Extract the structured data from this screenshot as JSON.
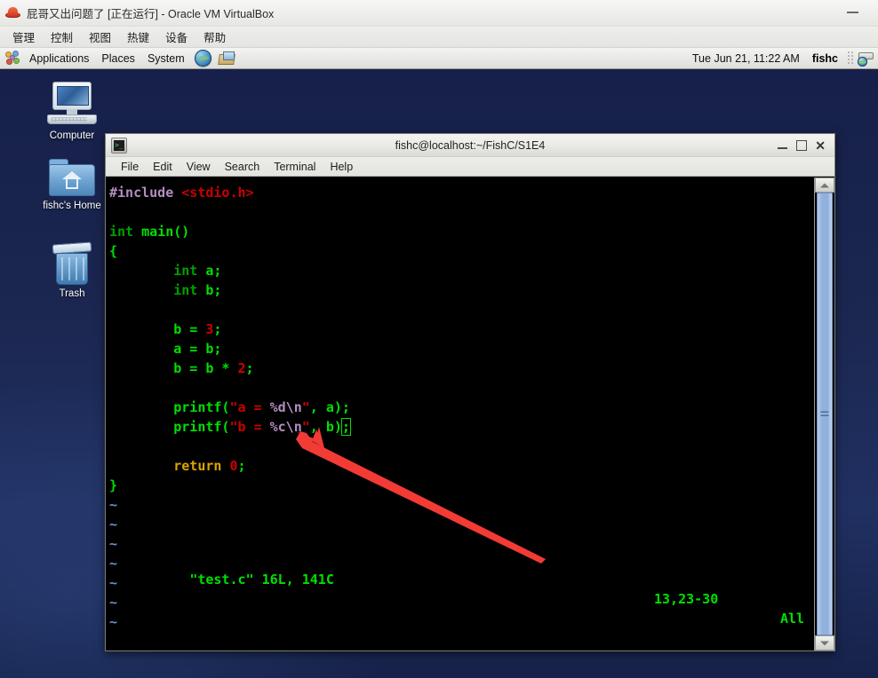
{
  "vbox": {
    "icon": "redhat-icon",
    "title_main": "屁哥又出问题了",
    "title_state": "[正在运行]",
    "title_app": "- Oracle VM VirtualBox",
    "title_full": "屁哥又出问题了 [正在运行] - Oracle VM VirtualBox",
    "minimize_label": "—",
    "menu": [
      {
        "label": "管理",
        "name": "vbox-menu-manage"
      },
      {
        "label": "控制",
        "name": "vbox-menu-control"
      },
      {
        "label": "视图",
        "name": "vbox-menu-view"
      },
      {
        "label": "热键",
        "name": "vbox-menu-hotkey"
      },
      {
        "label": "设备",
        "name": "vbox-menu-devices"
      },
      {
        "label": "帮助",
        "name": "vbox-menu-help"
      }
    ]
  },
  "gnome_panel": {
    "applications": "Applications",
    "places": "Places",
    "system": "System",
    "clock": "Tue Jun 21, 11:22 AM",
    "user": "fishc",
    "icons": {
      "apps": "applications-icon",
      "browser": "web-browser-icon",
      "mail": "evolution-mail-icon",
      "updates": "software-update-icon"
    }
  },
  "desktop": {
    "icons": [
      {
        "label": "Computer",
        "name": "desktop-icon-computer"
      },
      {
        "label": "fishc's Home",
        "name": "desktop-icon-home"
      },
      {
        "label": "Trash",
        "name": "desktop-icon-trash"
      }
    ]
  },
  "terminal": {
    "title": "fishc@localhost:~/FishC/S1E4",
    "menu": [
      {
        "label": "File",
        "name": "terminal-menu-file"
      },
      {
        "label": "Edit",
        "name": "terminal-menu-edit"
      },
      {
        "label": "View",
        "name": "terminal-menu-view"
      },
      {
        "label": "Search",
        "name": "terminal-menu-search"
      },
      {
        "label": "Terminal",
        "name": "terminal-menu-terminal"
      },
      {
        "label": "Help",
        "name": "terminal-menu-help"
      }
    ],
    "window_buttons": {
      "minimize": "_",
      "maximize": "□",
      "close": "✕"
    },
    "status": {
      "file": "\"test.c\" 16L, 141C",
      "position": "13,23-30",
      "scroll": "All"
    },
    "code": {
      "line01_include_kw": "#include ",
      "line01_header": "<stdio.h>",
      "line03_type": "int ",
      "line03_name": "main()",
      "line04_brace": "{",
      "line05_type": "int ",
      "line05_decl": "a;",
      "line06_type": "int ",
      "line06_decl": "b;",
      "line08_lhs": "b = ",
      "line08_num": "3",
      "line08_semi": ";",
      "line09_expr": "a = b;",
      "line10_lhs": "b = b * ",
      "line10_num": "2",
      "line10_semi": ";",
      "line12_call": "printf(",
      "line12_str_open": "\"a = ",
      "line12_fmt": "%d\\n",
      "line12_str_close": "\"",
      "line12_args": ", a);",
      "line13_call": "printf(",
      "line13_str_open": "\"b = ",
      "line13_fmt": "%c\\n",
      "line13_str_close": "\"",
      "line13_args": ", b)",
      "line13_cursor": ";",
      "line15_ret_kw": "return ",
      "line15_num": "0",
      "line15_semi": ";",
      "line16_brace": "}",
      "tilde": "~"
    }
  },
  "annotation": {
    "arrow_color": "#f23b35",
    "arrow_name": "red-pointer-arrow",
    "points_at": "semicolon at end of printf b line"
  },
  "colors": {
    "desktop_bg": "#1b2750",
    "terminal_bg": "#000000",
    "syntax_preproc": "#b38ec1",
    "syntax_string": "#cc0000",
    "syntax_type": "#00a000",
    "syntax_ident": "#00e000",
    "syntax_return": "#d9a300",
    "syntax_tilde": "#6d8fd0",
    "accent_red": "#f23b35"
  }
}
